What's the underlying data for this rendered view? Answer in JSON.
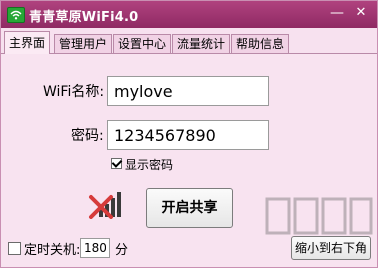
{
  "window": {
    "title": "青青草原WiFi4.0",
    "min_symbol": "—",
    "close_symbol": "✕"
  },
  "tabs": [
    {
      "label": "主界面",
      "active": true
    },
    {
      "label": "管理用户"
    },
    {
      "label": "设置中心"
    },
    {
      "label": "流量统计"
    },
    {
      "label": "帮助信息"
    }
  ],
  "main": {
    "wifi_name_label": "WiFi名称:",
    "wifi_name_value": "mylove",
    "password_label": "密码:",
    "password_value": "1234567890",
    "show_password_label": "显示密码",
    "show_password_checked": true,
    "signal_status": "no-signal",
    "start_share_button": "开启共享"
  },
  "footer": {
    "timer_label": "定时关机:",
    "timer_checked": false,
    "timer_value": "180",
    "timer_unit": "分",
    "minimize_to_corner_button": "缩小到右下角"
  },
  "colors": {
    "title_bar": "#9b3370",
    "background": "#f8e3f0",
    "signal_bar": "#3a3a3a",
    "cross": "#d63b3b"
  },
  "icons": [
    "wifi-app-icon",
    "signal-strength-icon",
    "minimize-icon",
    "close-icon"
  ]
}
